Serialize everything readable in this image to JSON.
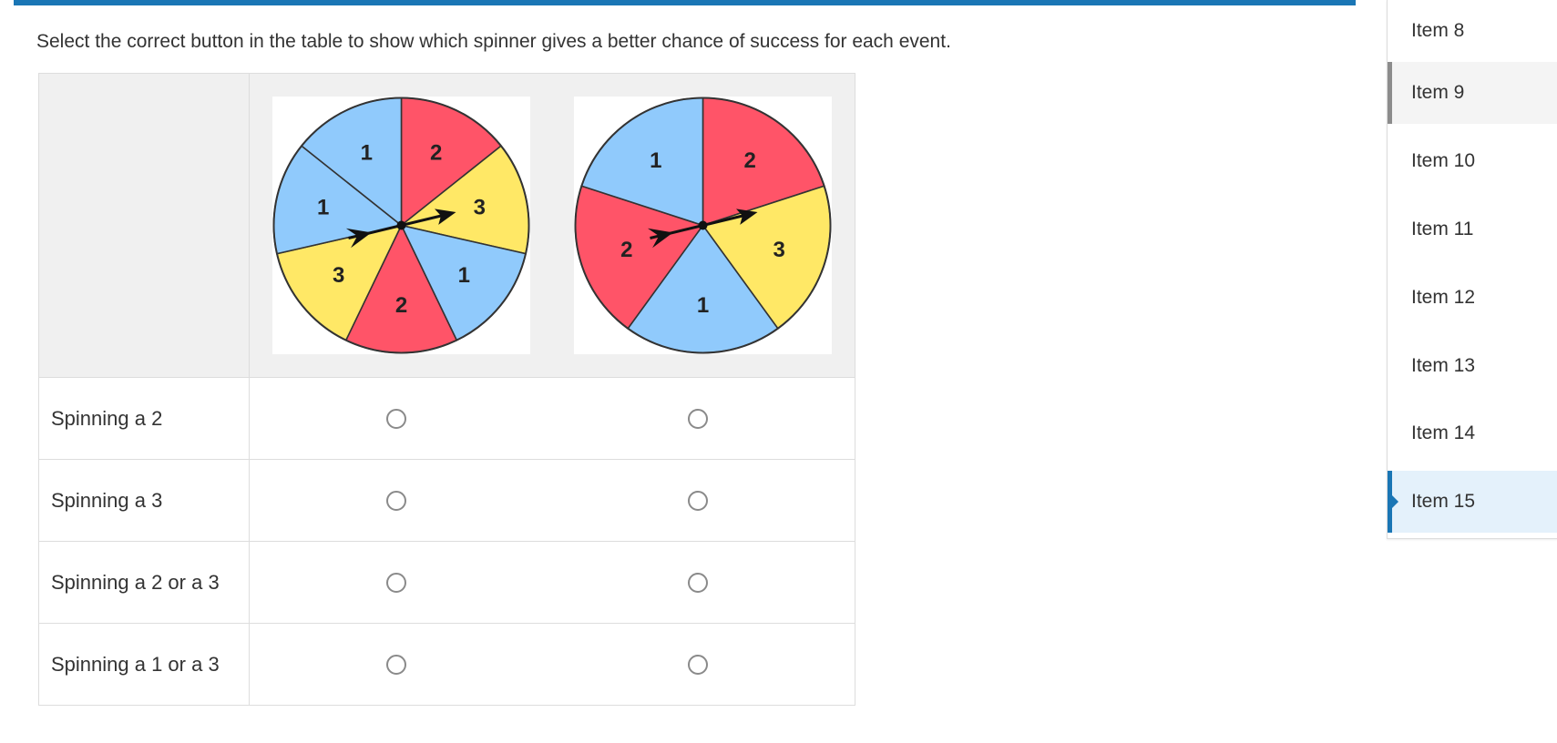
{
  "instructions": "Select the correct button in the table to show which spinner gives a better chance of success for each event.",
  "colors": {
    "accent": "#1a76b5",
    "spinner_blue": "#90cafc",
    "spinner_red": "#ff5468",
    "spinner_yellow": "#ffe866"
  },
  "spinners": [
    {
      "sections": [
        {
          "label": "2",
          "color": "red"
        },
        {
          "label": "3",
          "color": "yellow"
        },
        {
          "label": "1",
          "color": "blue"
        },
        {
          "label": "2",
          "color": "red"
        },
        {
          "label": "3",
          "color": "yellow"
        },
        {
          "label": "1",
          "color": "blue"
        },
        {
          "label": "1",
          "color": "blue"
        }
      ]
    },
    {
      "sections": [
        {
          "label": "2",
          "color": "red"
        },
        {
          "label": "3",
          "color": "yellow"
        },
        {
          "label": "1",
          "color": "blue"
        },
        {
          "label": "2",
          "color": "red"
        },
        {
          "label": "1",
          "color": "blue"
        }
      ]
    }
  ],
  "rows": [
    {
      "label": "Spinning a 2"
    },
    {
      "label": "Spinning a 3"
    },
    {
      "label": "Spinning a 2 or a 3"
    },
    {
      "label": "Spinning a 1 or a 3"
    }
  ],
  "sidebar": {
    "items": [
      {
        "label": "Item 8",
        "state": "normal"
      },
      {
        "label": "Item 9",
        "state": "hover"
      },
      {
        "label": "Item 10",
        "state": "normal"
      },
      {
        "label": "Item 11",
        "state": "normal"
      },
      {
        "label": "Item 12",
        "state": "normal"
      },
      {
        "label": "Item 13",
        "state": "normal"
      },
      {
        "label": "Item 14",
        "state": "normal"
      },
      {
        "label": "Item 15",
        "state": "active"
      }
    ]
  }
}
